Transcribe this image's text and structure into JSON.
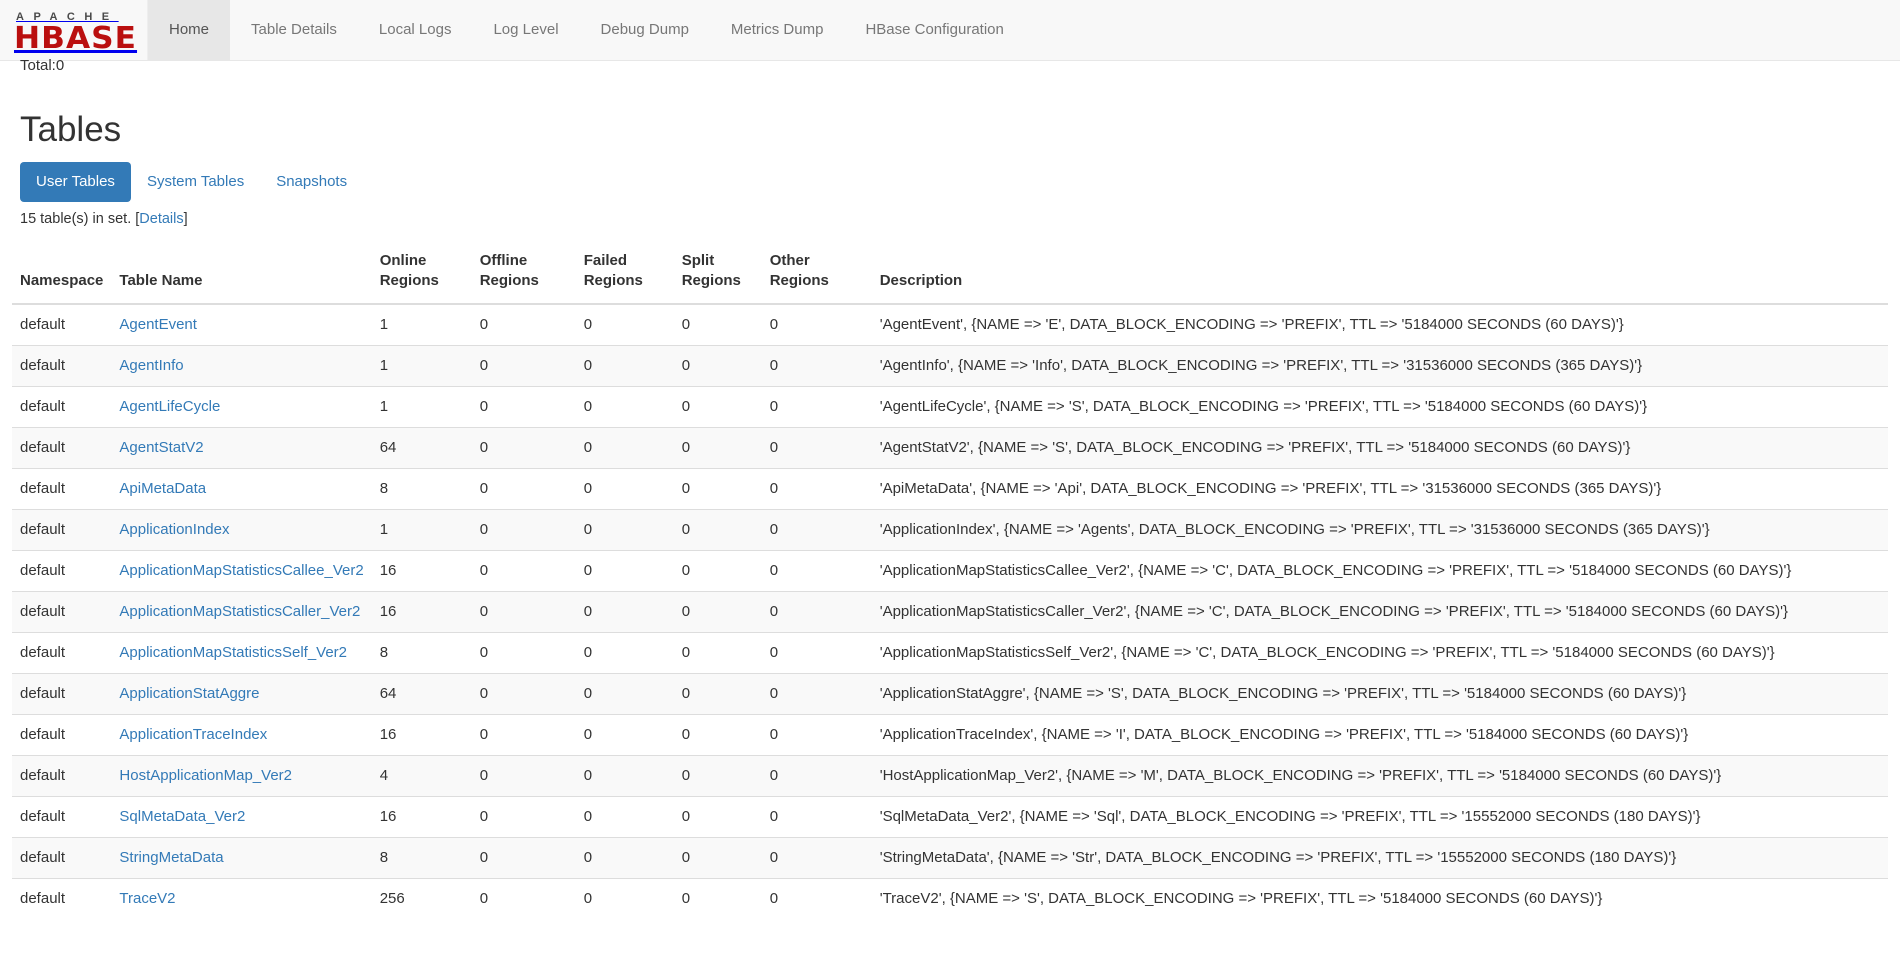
{
  "navbar": {
    "brand_line1": "APACHE",
    "brand_line2": "HBASE",
    "brand_color": "#ba0f0f",
    "items": [
      {
        "label": "Home",
        "active": true
      },
      {
        "label": "Table Details",
        "active": false
      },
      {
        "label": "Local Logs",
        "active": false
      },
      {
        "label": "Log Level",
        "active": false
      },
      {
        "label": "Debug Dump",
        "active": false
      },
      {
        "label": "Metrics Dump",
        "active": false
      },
      {
        "label": "HBase Configuration",
        "active": false
      }
    ]
  },
  "above_title": {
    "total_line": "Total:0"
  },
  "main": {
    "title": "Tables",
    "accent_color": "#337ab7",
    "tabs": [
      {
        "label": "User Tables",
        "active": true
      },
      {
        "label": "System Tables",
        "active": false
      },
      {
        "label": "Snapshots",
        "active": false
      }
    ],
    "set_count_prefix": "15 table(s) in set. [",
    "set_count_link": "Details",
    "set_count_suffix": "]",
    "columns": [
      "Namespace",
      "Table Name",
      "Online Regions",
      "Offline Regions",
      "Failed Regions",
      "Split Regions",
      "Other Regions",
      "Description"
    ],
    "rows": [
      {
        "namespace": "default",
        "table_name": "AgentEvent",
        "online": "1",
        "offline": "0",
        "failed": "0",
        "split": "0",
        "other": "0",
        "description": "'AgentEvent', {NAME => 'E', DATA_BLOCK_ENCODING => 'PREFIX', TTL => '5184000 SECONDS (60 DAYS)'}"
      },
      {
        "namespace": "default",
        "table_name": "AgentInfo",
        "online": "1",
        "offline": "0",
        "failed": "0",
        "split": "0",
        "other": "0",
        "description": "'AgentInfo', {NAME => 'Info', DATA_BLOCK_ENCODING => 'PREFIX', TTL => '31536000 SECONDS (365 DAYS)'}"
      },
      {
        "namespace": "default",
        "table_name": "AgentLifeCycle",
        "online": "1",
        "offline": "0",
        "failed": "0",
        "split": "0",
        "other": "0",
        "description": "'AgentLifeCycle', {NAME => 'S', DATA_BLOCK_ENCODING => 'PREFIX', TTL => '5184000 SECONDS (60 DAYS)'}"
      },
      {
        "namespace": "default",
        "table_name": "AgentStatV2",
        "online": "64",
        "offline": "0",
        "failed": "0",
        "split": "0",
        "other": "0",
        "description": "'AgentStatV2', {NAME => 'S', DATA_BLOCK_ENCODING => 'PREFIX', TTL => '5184000 SECONDS (60 DAYS)'}"
      },
      {
        "namespace": "default",
        "table_name": "ApiMetaData",
        "online": "8",
        "offline": "0",
        "failed": "0",
        "split": "0",
        "other": "0",
        "description": "'ApiMetaData', {NAME => 'Api', DATA_BLOCK_ENCODING => 'PREFIX', TTL => '31536000 SECONDS (365 DAYS)'}"
      },
      {
        "namespace": "default",
        "table_name": "ApplicationIndex",
        "online": "1",
        "offline": "0",
        "failed": "0",
        "split": "0",
        "other": "0",
        "description": "'ApplicationIndex', {NAME => 'Agents', DATA_BLOCK_ENCODING => 'PREFIX', TTL => '31536000 SECONDS (365 DAYS)'}"
      },
      {
        "namespace": "default",
        "table_name": "ApplicationMapStatisticsCallee_Ver2",
        "online": "16",
        "offline": "0",
        "failed": "0",
        "split": "0",
        "other": "0",
        "description": "'ApplicationMapStatisticsCallee_Ver2', {NAME => 'C', DATA_BLOCK_ENCODING => 'PREFIX', TTL => '5184000 SECONDS (60 DAYS)'}"
      },
      {
        "namespace": "default",
        "table_name": "ApplicationMapStatisticsCaller_Ver2",
        "online": "16",
        "offline": "0",
        "failed": "0",
        "split": "0",
        "other": "0",
        "description": "'ApplicationMapStatisticsCaller_Ver2', {NAME => 'C', DATA_BLOCK_ENCODING => 'PREFIX', TTL => '5184000 SECONDS (60 DAYS)'}"
      },
      {
        "namespace": "default",
        "table_name": "ApplicationMapStatisticsSelf_Ver2",
        "online": "8",
        "offline": "0",
        "failed": "0",
        "split": "0",
        "other": "0",
        "description": "'ApplicationMapStatisticsSelf_Ver2', {NAME => 'C', DATA_BLOCK_ENCODING => 'PREFIX', TTL => '5184000 SECONDS (60 DAYS)'}"
      },
      {
        "namespace": "default",
        "table_name": "ApplicationStatAggre",
        "online": "64",
        "offline": "0",
        "failed": "0",
        "split": "0",
        "other": "0",
        "description": "'ApplicationStatAggre', {NAME => 'S', DATA_BLOCK_ENCODING => 'PREFIX', TTL => '5184000 SECONDS (60 DAYS)'}"
      },
      {
        "namespace": "default",
        "table_name": "ApplicationTraceIndex",
        "online": "16",
        "offline": "0",
        "failed": "0",
        "split": "0",
        "other": "0",
        "description": "'ApplicationTraceIndex', {NAME => 'I', DATA_BLOCK_ENCODING => 'PREFIX', TTL => '5184000 SECONDS (60 DAYS)'}"
      },
      {
        "namespace": "default",
        "table_name": "HostApplicationMap_Ver2",
        "online": "4",
        "offline": "0",
        "failed": "0",
        "split": "0",
        "other": "0",
        "description": "'HostApplicationMap_Ver2', {NAME => 'M', DATA_BLOCK_ENCODING => 'PREFIX', TTL => '5184000 SECONDS (60 DAYS)'}"
      },
      {
        "namespace": "default",
        "table_name": "SqlMetaData_Ver2",
        "online": "16",
        "offline": "0",
        "failed": "0",
        "split": "0",
        "other": "0",
        "description": "'SqlMetaData_Ver2', {NAME => 'Sql', DATA_BLOCK_ENCODING => 'PREFIX', TTL => '15552000 SECONDS (180 DAYS)'}"
      },
      {
        "namespace": "default",
        "table_name": "StringMetaData",
        "online": "8",
        "offline": "0",
        "failed": "0",
        "split": "0",
        "other": "0",
        "description": "'StringMetaData', {NAME => 'Str', DATA_BLOCK_ENCODING => 'PREFIX', TTL => '15552000 SECONDS (180 DAYS)'}"
      },
      {
        "namespace": "default",
        "table_name": "TraceV2",
        "online": "256",
        "offline": "0",
        "failed": "0",
        "split": "0",
        "other": "0",
        "description": "'TraceV2', {NAME => 'S', DATA_BLOCK_ENCODING => 'PREFIX', TTL => '5184000 SECONDS (60 DAYS)'}"
      }
    ]
  }
}
